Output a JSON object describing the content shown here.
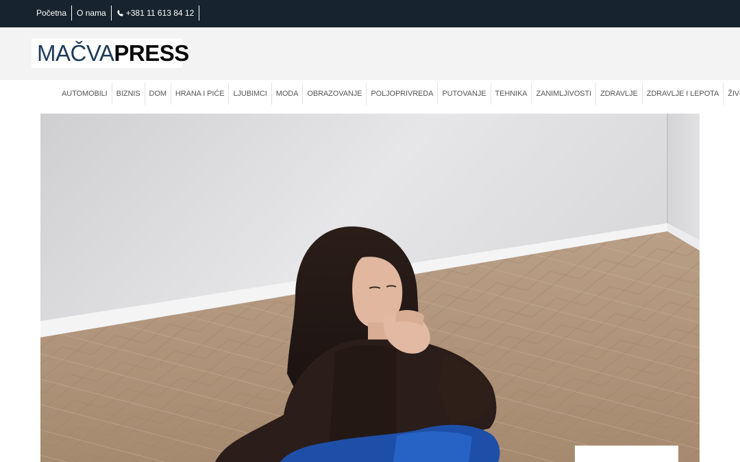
{
  "topbar": {
    "links": [
      {
        "label": "Početna"
      },
      {
        "label": "O nama"
      },
      {
        "label": "+381 11 613 84 12",
        "icon": "phone-icon"
      }
    ],
    "background": "#17242f"
  },
  "header": {
    "logo_part_1": "MAČVA",
    "logo_part_2": "PRESS",
    "logo_color_primary": "#1d3b5a",
    "background": "#f3f3f3"
  },
  "categories": [
    "AUTOMOBILI",
    "BIZNIS",
    "DOM",
    "HRANA I PIĆE",
    "LJUBIMCI",
    "MODA",
    "OBRAZOVANJE",
    "POLJOPRIVREDA",
    "PUTOVANJE",
    "TEHNIKA",
    "ZANIMLJIVOSTI",
    "ZDRAVLJE",
    "ZDRAVLJE I LEPOTA",
    "ŽIVOTINJE"
  ]
}
